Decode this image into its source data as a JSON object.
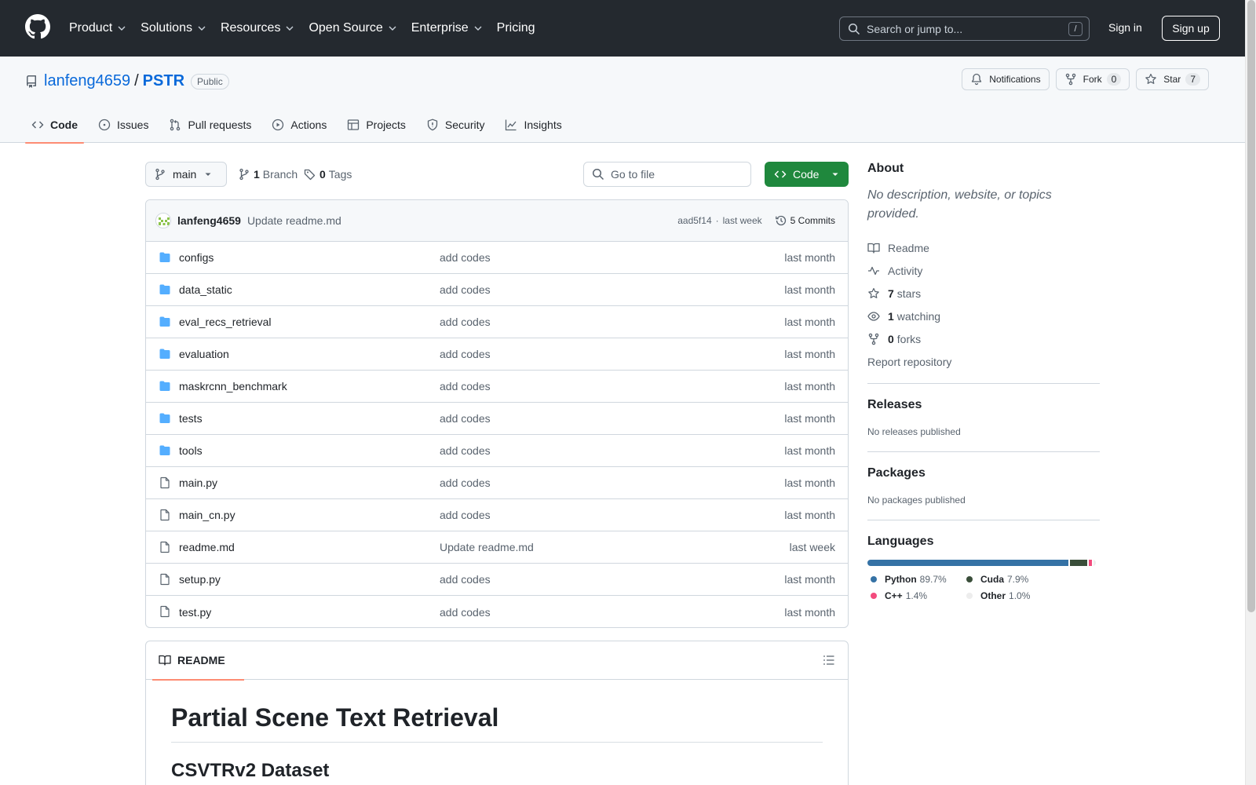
{
  "header": {
    "nav": [
      {
        "label": "Product",
        "has_chevron": true
      },
      {
        "label": "Solutions",
        "has_chevron": true
      },
      {
        "label": "Resources",
        "has_chevron": true
      },
      {
        "label": "Open Source",
        "has_chevron": true
      },
      {
        "label": "Enterprise",
        "has_chevron": true
      },
      {
        "label": "Pricing",
        "has_chevron": false
      }
    ],
    "search_placeholder": "Search or jump to...",
    "search_shortcut": "/",
    "signin": "Sign in",
    "signup": "Sign up"
  },
  "repo": {
    "owner": "lanfeng4659",
    "separator": "/",
    "name": "PSTR",
    "visibility": "Public",
    "notifications_label": "Notifications",
    "fork_label": "Fork",
    "fork_count": "0",
    "star_label": "Star",
    "star_count": "7",
    "tabs": [
      {
        "label": "Code",
        "icon": "code-icon",
        "active": true
      },
      {
        "label": "Issues",
        "icon": "issue-icon",
        "active": false
      },
      {
        "label": "Pull requests",
        "icon": "pull-request-icon",
        "active": false
      },
      {
        "label": "Actions",
        "icon": "play-icon",
        "active": false
      },
      {
        "label": "Projects",
        "icon": "table-icon",
        "active": false
      },
      {
        "label": "Security",
        "icon": "shield-icon",
        "active": false
      },
      {
        "label": "Insights",
        "icon": "graph-icon",
        "active": false
      }
    ]
  },
  "toolbar": {
    "branch": "main",
    "branch_count": "1",
    "branch_label": "Branch",
    "tag_count": "0",
    "tag_label": "Tags",
    "goto_placeholder": "Go to file",
    "code_button": "Code"
  },
  "latest_commit": {
    "author": "lanfeng4659",
    "message": "Update readme.md",
    "hash": "aad5f14",
    "separator": "·",
    "time": "last week",
    "commits_label": "5 Commits"
  },
  "files": [
    {
      "name": "configs",
      "type": "dir",
      "message": "add codes",
      "date": "last month"
    },
    {
      "name": "data_static",
      "type": "dir",
      "message": "add codes",
      "date": "last month"
    },
    {
      "name": "eval_recs_retrieval",
      "type": "dir",
      "message": "add codes",
      "date": "last month"
    },
    {
      "name": "evaluation",
      "type": "dir",
      "message": "add codes",
      "date": "last month"
    },
    {
      "name": "maskrcnn_benchmark",
      "type": "dir",
      "message": "add codes",
      "date": "last month"
    },
    {
      "name": "tests",
      "type": "dir",
      "message": "add codes",
      "date": "last month"
    },
    {
      "name": "tools",
      "type": "dir",
      "message": "add codes",
      "date": "last month"
    },
    {
      "name": "main.py",
      "type": "file",
      "message": "add codes",
      "date": "last month"
    },
    {
      "name": "main_cn.py",
      "type": "file",
      "message": "add codes",
      "date": "last month"
    },
    {
      "name": "readme.md",
      "type": "file",
      "message": "Update readme.md",
      "date": "last week"
    },
    {
      "name": "setup.py",
      "type": "file",
      "message": "add codes",
      "date": "last month"
    },
    {
      "name": "test.py",
      "type": "file",
      "message": "add codes",
      "date": "last month"
    }
  ],
  "readme": {
    "tab_label": "README",
    "h1": "Partial Scene Text Retrieval",
    "h2": "CSVTRv2 Dataset"
  },
  "sidebar": {
    "about_title": "About",
    "about_desc": "No description, website, or topics provided.",
    "links": [
      {
        "icon": "book-icon",
        "count": "",
        "label": "Readme"
      },
      {
        "icon": "pulse-icon",
        "count": "",
        "label": "Activity"
      },
      {
        "icon": "star-icon",
        "count": "7",
        "label": "stars"
      },
      {
        "icon": "eye-icon",
        "count": "1",
        "label": "watching"
      },
      {
        "icon": "fork-icon",
        "count": "0",
        "label": "forks"
      }
    ],
    "report": "Report repository",
    "releases_title": "Releases",
    "releases_text": "No releases published",
    "packages_title": "Packages",
    "packages_text": "No packages published",
    "languages_title": "Languages",
    "languages": [
      {
        "name": "Python",
        "percent": "89.7%",
        "value": 89.7,
        "color": "#3572A5"
      },
      {
        "name": "Cuda",
        "percent": "7.9%",
        "value": 7.9,
        "color": "#3A4E3A"
      },
      {
        "name": "C++",
        "percent": "1.4%",
        "value": 1.4,
        "color": "#f34b7d"
      },
      {
        "name": "Other",
        "percent": "1.0%",
        "value": 1.0,
        "color": "#ededed"
      }
    ]
  }
}
